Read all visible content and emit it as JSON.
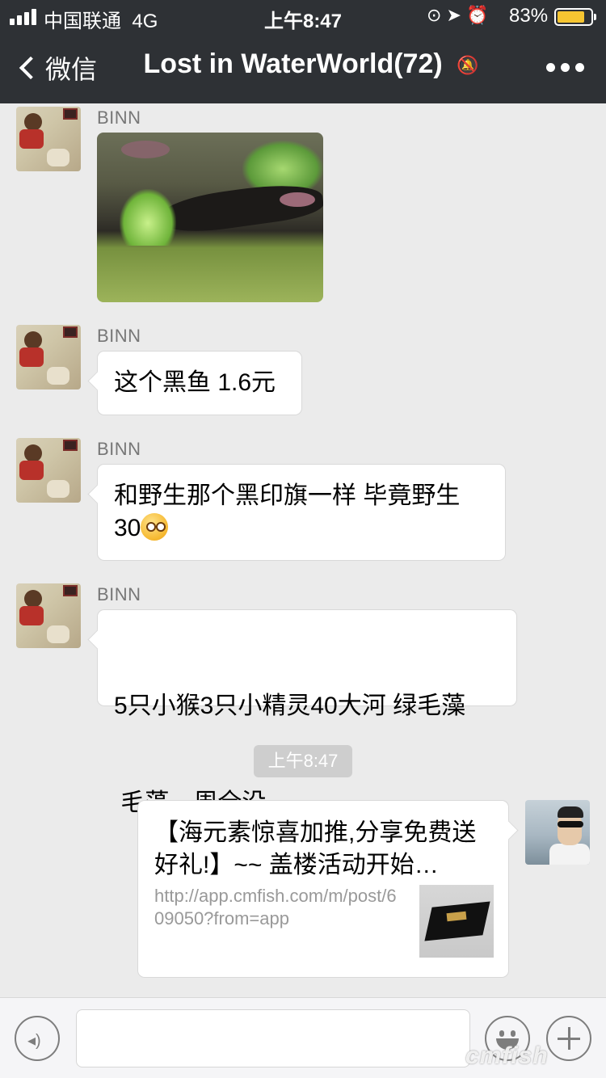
{
  "status_bar": {
    "carrier": "中国联通",
    "network": "4G",
    "time": "上午8:47",
    "status_icons": "⊙ ➤ ⏰",
    "battery_percent": "83%",
    "battery_level": 0.83,
    "battery_color": "#f6c531"
  },
  "nav": {
    "back_label": "微信",
    "title": "Lost in WaterWorld(72)",
    "mute_icon": "🔕",
    "more_icon": "ellipsis-icon"
  },
  "messages": [
    {
      "sender": "BINN",
      "type": "image"
    },
    {
      "sender": "BINN",
      "type": "text",
      "text": "这个黑鱼 1.6元"
    },
    {
      "sender": "BINN",
      "type": "text",
      "text_line1": "和野生那个黑印旗一样 毕竟野生",
      "text_line2": "30"
    },
    {
      "sender": "BINN",
      "type": "text",
      "text_line1": "5只小猴3只小精灵40大河 绿毛藻",
      "text_line2": " 毛藻一周全没"
    }
  ],
  "time_divider": "上午8:47",
  "link_card": {
    "title": "【海元素惊喜加推,分享免费送好礼!】~~ 盖楼活动开始…",
    "url": "http://app.cmfish.com/m/post/609050?from=app"
  },
  "input_bar": {
    "voice_icon": "voice-icon",
    "emoji_icon": "emoji-icon",
    "plus_icon": "plus-icon"
  },
  "watermark": "cmfish"
}
